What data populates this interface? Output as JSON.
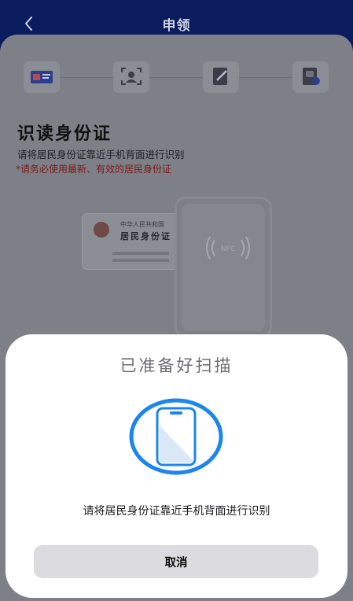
{
  "header": {
    "title": "申领",
    "back_icon": "chevron-left-icon"
  },
  "steps": {
    "icons": [
      "id-card-icon",
      "face-scan-icon",
      "document-sign-icon",
      "document-check-icon"
    ]
  },
  "main": {
    "heading": "识读身份证",
    "instruction": "请将居民身份证靠近手机背面进行识别",
    "warning": "*请务必使用最新、有效的居民身份证"
  },
  "illustration": {
    "card_line1": "中华人民共和国",
    "card_line2": "居民身份证",
    "nfc_label": "NFC"
  },
  "sheet": {
    "title": "已准备好扫描",
    "instruction": "请将居民身份证靠近手机背面进行识别",
    "cancel_label": "取消",
    "icon": "phone-scan-icon"
  },
  "colors": {
    "header_bg": "#0a1c5e",
    "accent_blue": "#1b86ee",
    "warning_red": "#d72b2b"
  }
}
